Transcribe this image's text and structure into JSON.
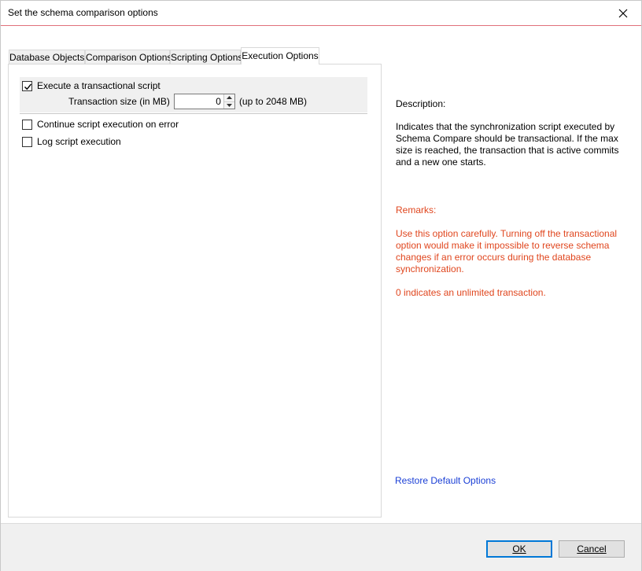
{
  "window": {
    "title": "Set the schema comparison options"
  },
  "tabs": [
    {
      "label": "Database Objects"
    },
    {
      "label": "Comparison Options"
    },
    {
      "label": "Scripting Options"
    },
    {
      "label": "Execution Options",
      "active": true
    }
  ],
  "options": {
    "transactional": {
      "label": "Execute a transactional script",
      "checked": true
    },
    "transaction_size": {
      "label": "Transaction size (in MB)",
      "value": "0",
      "hint": "(up to 2048 MB)"
    },
    "continue_on_error": {
      "label": "Continue script execution on error",
      "checked": false
    },
    "log_execution": {
      "label": "Log script execution",
      "checked": false
    }
  },
  "description": {
    "label": "Description:",
    "text": "Indicates that the synchronization script executed by Schema Compare should be transactional. If the max size is reached, the transaction that is active commits and a new one starts."
  },
  "remarks": {
    "label": "Remarks:",
    "text": "Use this option carefully. Turning off the transactional option would make it impossible to reverse schema changes if an error occurs during the database synchronization.",
    "note": "0 indicates an unlimited transaction."
  },
  "restore_link": "Restore Default Options",
  "buttons": {
    "ok": "OK",
    "cancel": "Cancel"
  },
  "colors": {
    "accent": "#0078d7",
    "remarks": "#e0461e",
    "link": "#1a3fd6"
  }
}
